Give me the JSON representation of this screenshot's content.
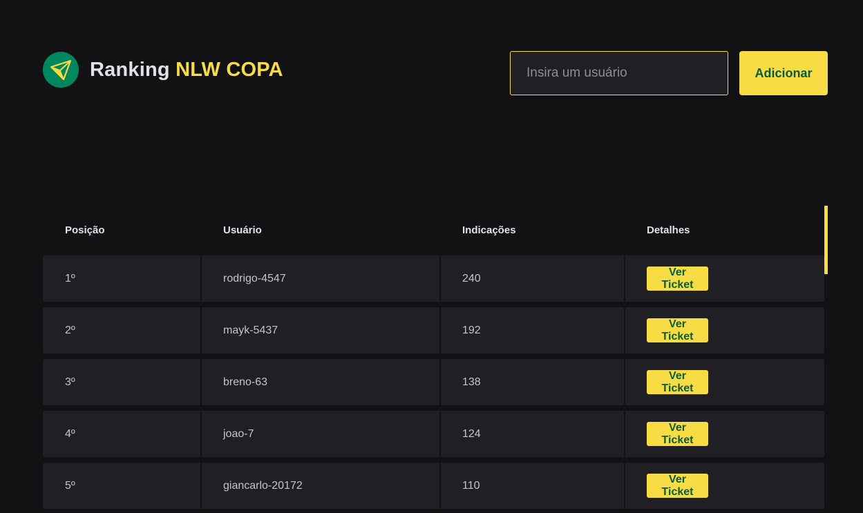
{
  "header": {
    "title_main": "Ranking",
    "title_accent": "NLW COPA",
    "logo_icon": "paper-plane-icon"
  },
  "search": {
    "placeholder": "Insira um usuário",
    "value": ""
  },
  "add_button_label": "Adicionar",
  "table": {
    "columns": [
      "Posição",
      "Usuário",
      "Indicações",
      "Detalhes"
    ],
    "rows": [
      {
        "position": "1º",
        "user": "rodrigo-4547",
        "referrals": "240",
        "action": "Ver Ticket"
      },
      {
        "position": "2º",
        "user": "mayk-5437",
        "referrals": "192",
        "action": "Ver Ticket"
      },
      {
        "position": "3º",
        "user": "breno-63",
        "referrals": "138",
        "action": "Ver Ticket"
      },
      {
        "position": "4º",
        "user": "joao-7",
        "referrals": "124",
        "action": "Ver Ticket"
      },
      {
        "position": "5º",
        "user": "giancarlo-20172",
        "referrals": "110",
        "action": "Ver Ticket"
      }
    ]
  },
  "colors": {
    "background": "#121214",
    "surface": "#202024",
    "accent": "#f7dd43",
    "brand_green": "#00875f",
    "button_text": "#0c5b38"
  }
}
